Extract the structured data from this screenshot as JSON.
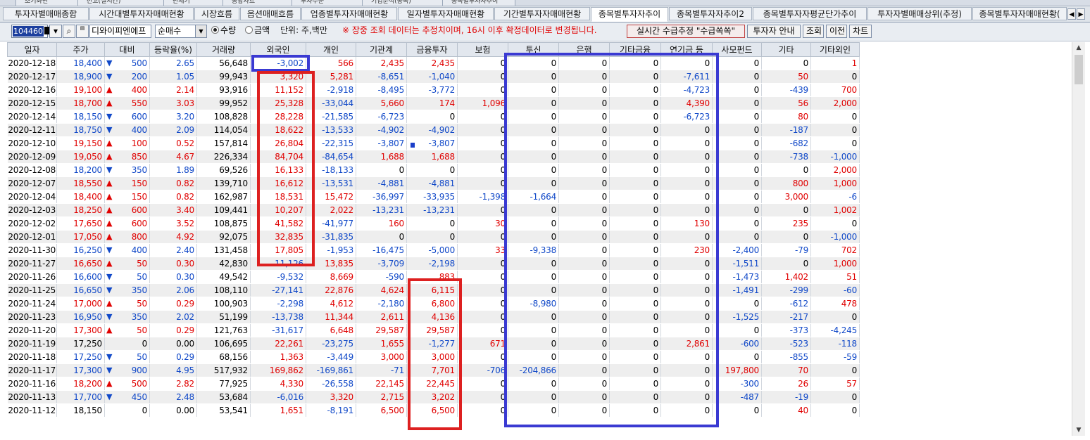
{
  "top_strip": {
    "tabs": [
      "조기화면",
      "잔고(실시간)",
      "단체기",
      "종합차트",
      "투자주문",
      "기업분석(종목)",
      "종목별투자자추이"
    ]
  },
  "tabs": [
    "투자자별매매종합",
    "시간대별투자자매매현황",
    "시장흐름",
    "옵션매매흐름",
    "업종별투자자매매현황",
    "일자별투자자매매현황",
    "기간별투자자매매현황",
    "종목별투자자추이",
    "종목별투자자추이2",
    "종목별투자자평균단가추이",
    "투자자별매매상위(추정)",
    "종목별투자자매매현황("
  ],
  "tab_nav": {
    "prev": "◀",
    "next": "▶"
  },
  "toolbar": {
    "code": "104460",
    "search_icon": "magnifier-icon",
    "stock_name": "디와이피엔에프",
    "mode": "순매수",
    "radio_qty": "수량",
    "radio_amt": "금액",
    "unit_label": "단위: 주,백만",
    "notice": "※ 장중 조회 데이터는 추정치이며, 16시 이후 확정데이터로 변경됩니다.",
    "btn_realtime": "실시간 수급추정 \"수급쏙쏙\"",
    "btn_investor_guide": "투자자 안내",
    "btn_query": "조회",
    "btn_prev": "이전",
    "btn_chart": "차트"
  },
  "columns": [
    "일자",
    "주가",
    "대비",
    "등락율(%)",
    "거래량",
    "외국인",
    "개인",
    "기관계",
    "금융투자",
    "보험",
    "투신",
    "은행",
    "기타금융",
    "연기금 등",
    "사모펀드",
    "기타",
    "기타외인"
  ],
  "rows": [
    {
      "date": "2020-12-18",
      "price": "18,400",
      "dir": "dn",
      "chg": "500",
      "rate": "2.65",
      "vol": "56,648",
      "v": [
        "-3,002",
        "566",
        "2,435",
        "2,435",
        "0",
        "0",
        "0",
        "0",
        "0",
        "0",
        "0",
        "1"
      ]
    },
    {
      "date": "2020-12-17",
      "price": "18,900",
      "dir": "dn",
      "chg": "200",
      "rate": "1.05",
      "vol": "99,943",
      "v": [
        "3,320",
        "5,281",
        "-8,651",
        "-1,040",
        "0",
        "0",
        "0",
        "0",
        "-7,611",
        "0",
        "50",
        "0"
      ]
    },
    {
      "date": "2020-12-16",
      "price": "19,100",
      "dir": "up",
      "chg": "400",
      "rate": "2.14",
      "vol": "93,916",
      "v": [
        "11,152",
        "-2,918",
        "-8,495",
        "-3,772",
        "0",
        "0",
        "0",
        "0",
        "-4,723",
        "0",
        "-439",
        "700"
      ]
    },
    {
      "date": "2020-12-15",
      "price": "18,700",
      "dir": "up",
      "chg": "550",
      "rate": "3.03",
      "vol": "99,952",
      "v": [
        "25,328",
        "-33,044",
        "5,660",
        "174",
        "1,096",
        "0",
        "0",
        "0",
        "4,390",
        "0",
        "56",
        "2,000"
      ]
    },
    {
      "date": "2020-12-14",
      "price": "18,150",
      "dir": "dn",
      "chg": "600",
      "rate": "3.20",
      "vol": "108,828",
      "v": [
        "28,228",
        "-21,585",
        "-6,723",
        "0",
        "0",
        "0",
        "0",
        "0",
        "-6,723",
        "0",
        "80",
        "0"
      ]
    },
    {
      "date": "2020-12-11",
      "price": "18,750",
      "dir": "dn",
      "chg": "400",
      "rate": "2.09",
      "vol": "114,054",
      "v": [
        "18,622",
        "-13,533",
        "-4,902",
        "-4,902",
        "0",
        "0",
        "0",
        "0",
        "0",
        "0",
        "-187",
        "0"
      ]
    },
    {
      "date": "2020-12-10",
      "price": "19,150",
      "dir": "up",
      "chg": "100",
      "rate": "0.52",
      "vol": "157,814",
      "v": [
        "26,804",
        "-22,315",
        "-3,807",
        "-3,807",
        "0",
        "0",
        "0",
        "0",
        "0",
        "0",
        "-682",
        "0"
      ],
      "marker": true
    },
    {
      "date": "2020-12-09",
      "price": "19,050",
      "dir": "up",
      "chg": "850",
      "rate": "4.67",
      "vol": "226,334",
      "v": [
        "84,704",
        "-84,654",
        "1,688",
        "1,688",
        "0",
        "0",
        "0",
        "0",
        "0",
        "0",
        "-738",
        "-1,000"
      ]
    },
    {
      "date": "2020-12-08",
      "price": "18,200",
      "dir": "dn",
      "chg": "350",
      "rate": "1.89",
      "vol": "69,526",
      "v": [
        "16,133",
        "-18,133",
        "0",
        "0",
        "0",
        "0",
        "0",
        "0",
        "0",
        "0",
        "0",
        "2,000"
      ]
    },
    {
      "date": "2020-12-07",
      "price": "18,550",
      "dir": "up",
      "chg": "150",
      "rate": "0.82",
      "vol": "139,710",
      "v": [
        "16,612",
        "-13,531",
        "-4,881",
        "-4,881",
        "0",
        "0",
        "0",
        "0",
        "0",
        "0",
        "800",
        "1,000"
      ]
    },
    {
      "date": "2020-12-04",
      "price": "18,400",
      "dir": "up",
      "chg": "150",
      "rate": "0.82",
      "vol": "162,987",
      "v": [
        "18,531",
        "15,472",
        "-36,997",
        "-33,935",
        "-1,398",
        "-1,664",
        "0",
        "0",
        "0",
        "0",
        "3,000",
        "-6"
      ]
    },
    {
      "date": "2020-12-03",
      "price": "18,250",
      "dir": "up",
      "chg": "600",
      "rate": "3.40",
      "vol": "109,441",
      "v": [
        "10,207",
        "2,022",
        "-13,231",
        "-13,231",
        "0",
        "0",
        "0",
        "0",
        "0",
        "0",
        "0",
        "1,002"
      ]
    },
    {
      "date": "2020-12-02",
      "price": "17,650",
      "dir": "up",
      "chg": "600",
      "rate": "3.52",
      "vol": "108,875",
      "v": [
        "41,582",
        "-41,977",
        "160",
        "0",
        "30",
        "0",
        "0",
        "0",
        "130",
        "0",
        "235",
        "0"
      ]
    },
    {
      "date": "2020-12-01",
      "price": "17,050",
      "dir": "up",
      "chg": "800",
      "rate": "4.92",
      "vol": "92,075",
      "v": [
        "32,835",
        "-31,835",
        "0",
        "0",
        "0",
        "0",
        "0",
        "0",
        "0",
        "0",
        "0",
        "-1,000"
      ]
    },
    {
      "date": "2020-11-30",
      "price": "16,250",
      "dir": "dn",
      "chg": "400",
      "rate": "2.40",
      "vol": "131,458",
      "v": [
        "17,805",
        "-1,953",
        "-16,475",
        "-5,000",
        "33",
        "-9,338",
        "0",
        "0",
        "230",
        "-2,400",
        "-79",
        "702"
      ]
    },
    {
      "date": "2020-11-27",
      "price": "16,650",
      "dir": "up",
      "chg": "50",
      "rate": "0.30",
      "vol": "42,830",
      "v": [
        "-11,126",
        "13,835",
        "-3,709",
        "-2,198",
        "0",
        "0",
        "0",
        "0",
        "0",
        "-1,511",
        "0",
        "1,000"
      ]
    },
    {
      "date": "2020-11-26",
      "price": "16,600",
      "dir": "dn",
      "chg": "50",
      "rate": "0.30",
      "vol": "49,542",
      "v": [
        "-9,532",
        "8,669",
        "-590",
        "883",
        "0",
        "0",
        "0",
        "0",
        "0",
        "-1,473",
        "1,402",
        "51"
      ]
    },
    {
      "date": "2020-11-25",
      "price": "16,650",
      "dir": "dn",
      "chg": "350",
      "rate": "2.06",
      "vol": "108,110",
      "v": [
        "-27,141",
        "22,876",
        "4,624",
        "6,115",
        "0",
        "0",
        "0",
        "0",
        "0",
        "-1,491",
        "-299",
        "-60"
      ]
    },
    {
      "date": "2020-11-24",
      "price": "17,000",
      "dir": "up",
      "chg": "50",
      "rate": "0.29",
      "vol": "100,903",
      "v": [
        "-2,298",
        "4,612",
        "-2,180",
        "6,800",
        "0",
        "-8,980",
        "0",
        "0",
        "0",
        "0",
        "-612",
        "478"
      ]
    },
    {
      "date": "2020-11-23",
      "price": "16,950",
      "dir": "dn",
      "chg": "350",
      "rate": "2.02",
      "vol": "51,199",
      "v": [
        "-13,738",
        "11,344",
        "2,611",
        "4,136",
        "0",
        "0",
        "0",
        "0",
        "0",
        "-1,525",
        "-217",
        "0"
      ]
    },
    {
      "date": "2020-11-20",
      "price": "17,300",
      "dir": "up",
      "chg": "50",
      "rate": "0.29",
      "vol": "121,763",
      "v": [
        "-31,617",
        "6,648",
        "29,587",
        "29,587",
        "0",
        "0",
        "0",
        "0",
        "0",
        "0",
        "-373",
        "-4,245"
      ]
    },
    {
      "date": "2020-11-19",
      "price": "17,250",
      "dir": "none",
      "chg": "0",
      "rate": "0.00",
      "vol": "106,695",
      "v": [
        "22,261",
        "-23,275",
        "1,655",
        "-1,277",
        "671",
        "0",
        "0",
        "0",
        "2,861",
        "-600",
        "-523",
        "-118"
      ]
    },
    {
      "date": "2020-11-18",
      "price": "17,250",
      "dir": "dn",
      "chg": "50",
      "rate": "0.29",
      "vol": "68,156",
      "v": [
        "1,363",
        "-3,449",
        "3,000",
        "3,000",
        "0",
        "0",
        "0",
        "0",
        "0",
        "0",
        "-855",
        "-59"
      ]
    },
    {
      "date": "2020-11-17",
      "price": "17,300",
      "dir": "dn",
      "chg": "900",
      "rate": "4.95",
      "vol": "517,932",
      "v": [
        "169,862",
        "-169,861",
        "-71",
        "7,701",
        "-706",
        "-204,866",
        "0",
        "0",
        "0",
        "197,800",
        "70",
        "0"
      ]
    },
    {
      "date": "2020-11-16",
      "price": "18,200",
      "dir": "up",
      "chg": "500",
      "rate": "2.82",
      "vol": "77,925",
      "v": [
        "4,330",
        "-26,558",
        "22,145",
        "22,445",
        "0",
        "0",
        "0",
        "0",
        "0",
        "-300",
        "26",
        "57"
      ]
    },
    {
      "date": "2020-11-13",
      "price": "17,700",
      "dir": "dn",
      "chg": "450",
      "rate": "2.48",
      "vol": "53,684",
      "v": [
        "-6,016",
        "3,320",
        "2,715",
        "3,202",
        "0",
        "0",
        "0",
        "0",
        "0",
        "-487",
        "-19",
        "0"
      ]
    },
    {
      "date": "2020-11-12",
      "price": "18,150",
      "dir": "none",
      "chg": "0",
      "rate": "0.00",
      "vol": "53,541",
      "v": [
        "1,651",
        "-8,191",
        "6,500",
        "6,500",
        "0",
        "0",
        "0",
        "0",
        "0",
        "0",
        "40",
        "0"
      ]
    }
  ],
  "colors": {
    "up": "#e00000",
    "down": "#1048c8",
    "annotation_blue": "#3a3ad2",
    "annotation_red": "#dd2020"
  }
}
